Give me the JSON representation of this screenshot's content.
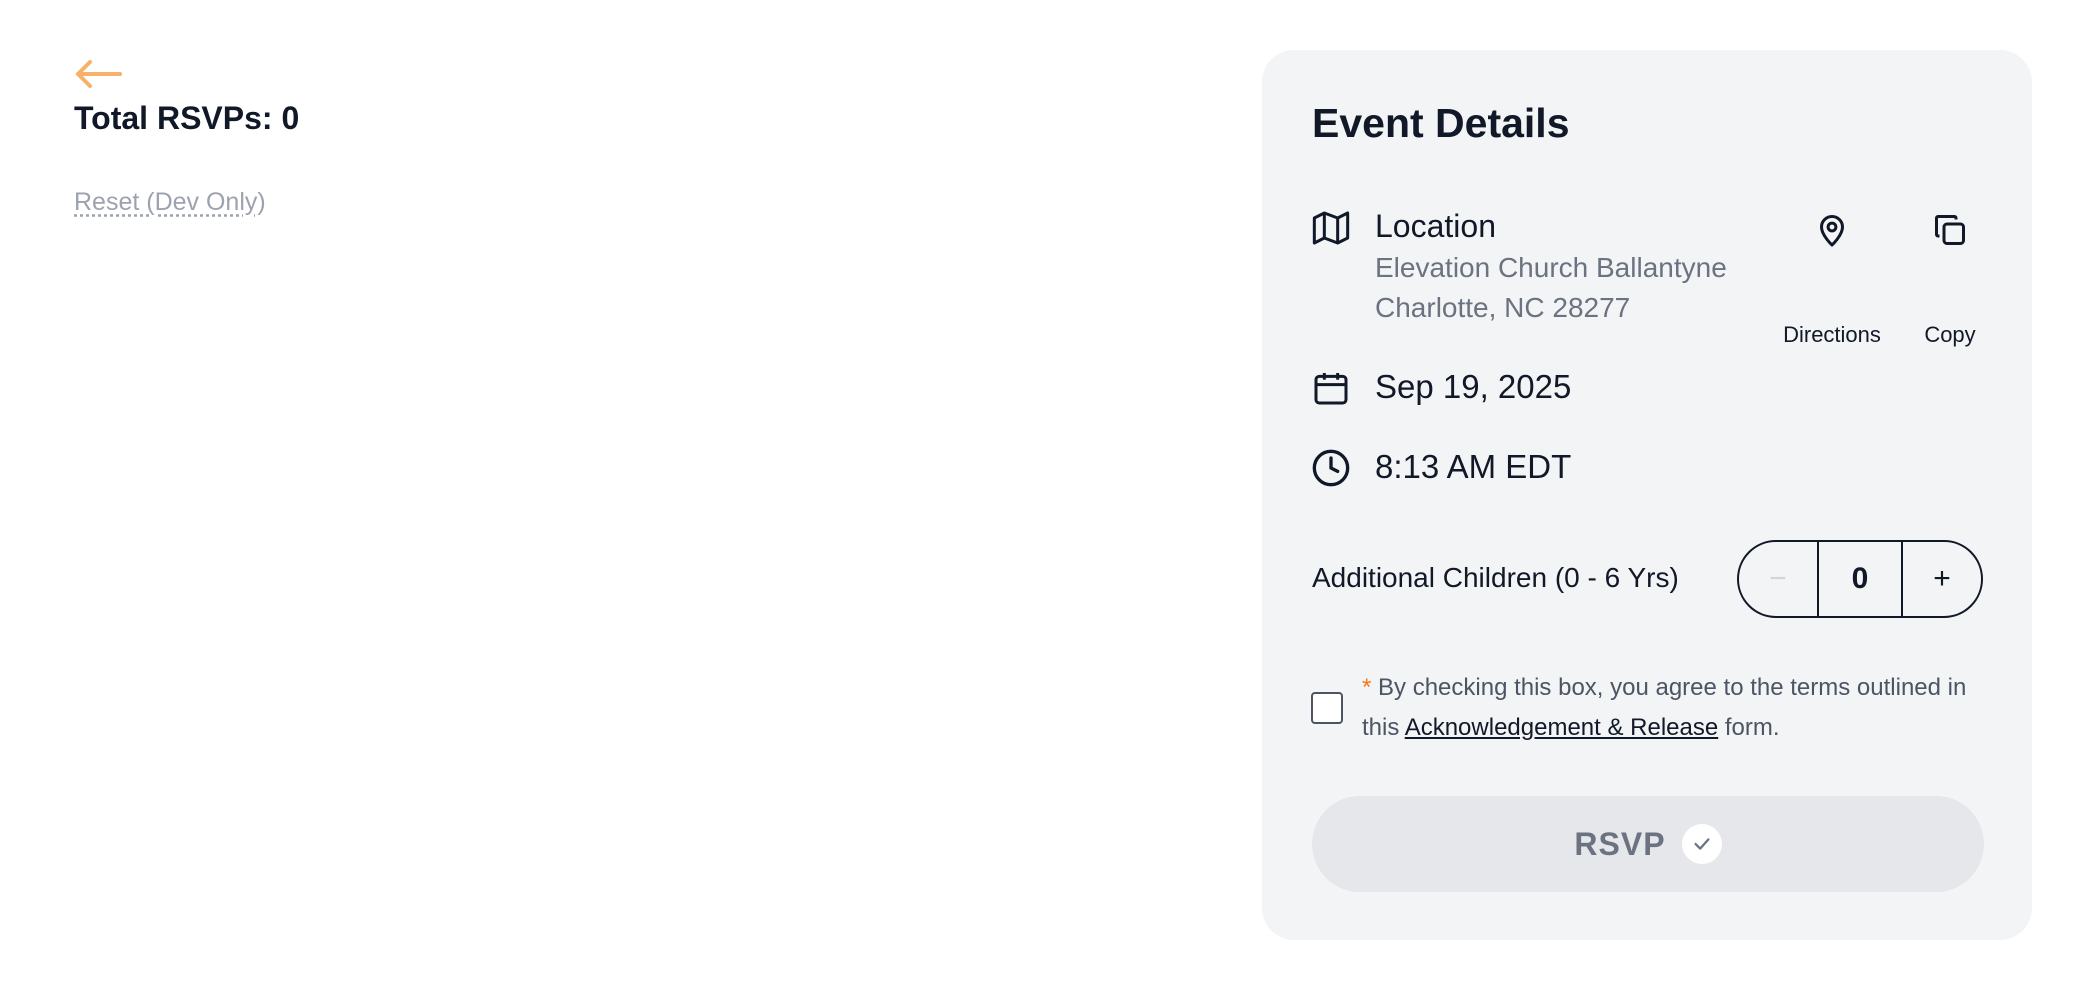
{
  "header": {
    "back_icon": "arrow-left-icon",
    "total_rsvps": "Total RSVPs: 0",
    "reset_label": "Reset (Dev Only)"
  },
  "event": {
    "title": "Event Details",
    "location": {
      "icon": "map-icon",
      "label": "Location",
      "line1": "Elevation Church Ballantyne",
      "line2": "Charlotte, NC 28277"
    },
    "actions": {
      "directions_icon": "map-pin-icon",
      "directions_label": "Directions",
      "copy_icon": "copy-icon",
      "copy_label": "Copy"
    },
    "date": {
      "icon": "calendar-icon",
      "text": "Sep 19, 2025"
    },
    "time": {
      "icon": "clock-icon",
      "text": "8:13 AM EDT"
    },
    "children": {
      "label": "Additional Children (0 - 6 Yrs)",
      "minus": "−",
      "value": "0",
      "plus": "+"
    },
    "terms": {
      "asterisk": "*",
      "text_before": " By checking this box, you agree to the terms outlined in this ",
      "link": "Acknowledgement & Release",
      "text_after": " form."
    },
    "rsvp": {
      "label": "RSVP",
      "icon": "check-icon"
    }
  },
  "colors": {
    "accent": "#f6b26b",
    "card_bg": "#f3f4f6",
    "asterisk": "#f97316",
    "muted_text": "#6b7280",
    "button_bg": "#e5e7eb"
  }
}
